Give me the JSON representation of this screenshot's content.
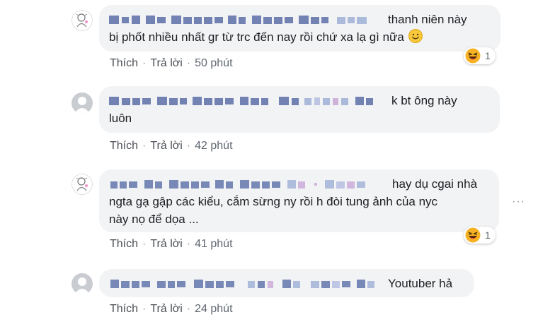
{
  "comments": [
    {
      "text": "thanh niên này bị phốt nhiều nhất gr từ trc đến nay rồi chứ xa lạ gì nữa",
      "line1": "thanh niên này",
      "line2": "bị phốt nhiều nhất gr từ trc đến nay rồi chứ xa lạ gì nữa",
      "reaction_count": "1",
      "like_label": "Thích",
      "reply_label": "Trả lời",
      "time": "50 phút"
    },
    {
      "text": "k bt ông này luôn",
      "line1": "k bt ông này",
      "line2": "luôn",
      "like_label": "Thích",
      "reply_label": "Trả lời",
      "time": "42 phút"
    },
    {
      "text": "hay dụ cgai nhà ngta gạ gập các kiểu, cắm sừng ny rồi h đòi tung ảnh của nyc này nọ để dọa ...",
      "line1": "hay dụ cgai nhà",
      "line2": "ngta gạ gập các kiểu, cắm sừng ny rồi h đòi tung ảnh của nyc",
      "line3": "này nọ để dọa ...",
      "reaction_count": "1",
      "more_label": "···",
      "like_label": "Thích",
      "reply_label": "Trả lời",
      "time": "41 phút"
    },
    {
      "text": "Youtuber hả",
      "line1": "Youtuber hả",
      "like_label": "Thích",
      "reply_label": "Trả lời",
      "time": "24 phút"
    }
  ],
  "colors": {
    "bubble": "#f2f3f5",
    "action_text": "#606770",
    "name_blur": "#385898",
    "reaction_emoji": "#f7b125"
  },
  "icons": [
    "avatar-drawing",
    "avatar-default",
    "smile-emoji",
    "haha-reaction-icon",
    "more-options-icon"
  ]
}
